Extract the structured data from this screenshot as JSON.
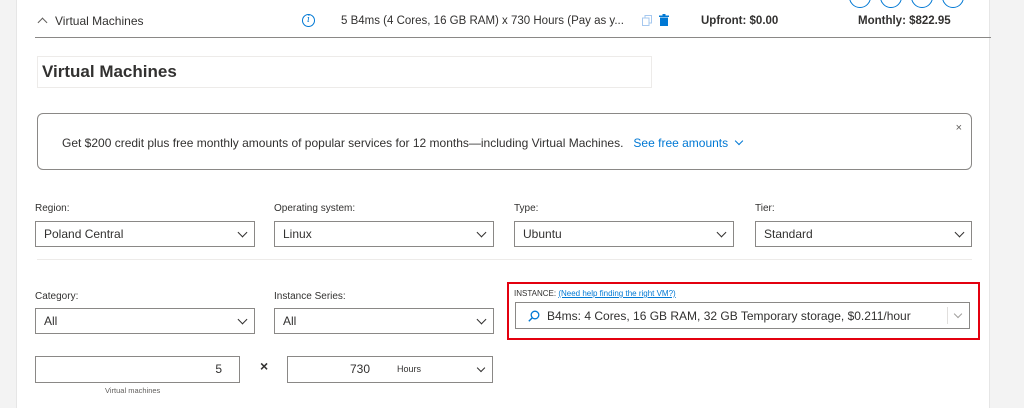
{
  "summary": {
    "title": "Virtual Machines",
    "description": "5 B4ms (4 Cores, 16 GB RAM) x 730 Hours (Pay as y...",
    "upfront": "Upfront: $0.00",
    "monthly": "Monthly: $822.95"
  },
  "name_input": {
    "value": "Virtual Machines"
  },
  "banner": {
    "text": "Get $200 credit plus free monthly amounts of popular services for 12 months—including Virtual Machines.",
    "link": "See free amounts",
    "close": "×"
  },
  "fields": {
    "region": {
      "label": "Region:",
      "value": "Poland Central"
    },
    "os": {
      "label": "Operating system:",
      "value": "Linux"
    },
    "type": {
      "label": "Type:",
      "value": "Ubuntu"
    },
    "tier": {
      "label": "Tier:",
      "value": "Standard"
    },
    "category": {
      "label": "Category:",
      "value": "All"
    },
    "series": {
      "label": "Instance Series:",
      "value": "All"
    }
  },
  "instance": {
    "label": "INSTANCE:",
    "help_link": "(Need help finding the right VM?)",
    "value": "B4ms: 4 Cores, 16 GB RAM, 32 GB Temporary storage, $0.211/hour"
  },
  "quantity": {
    "vms": "5",
    "vms_caption": "Virtual machines",
    "times": "×",
    "hours": "730",
    "hours_unit": "Hours"
  },
  "colors": {
    "accent": "#0078d4",
    "highlight": "#e3000f"
  }
}
